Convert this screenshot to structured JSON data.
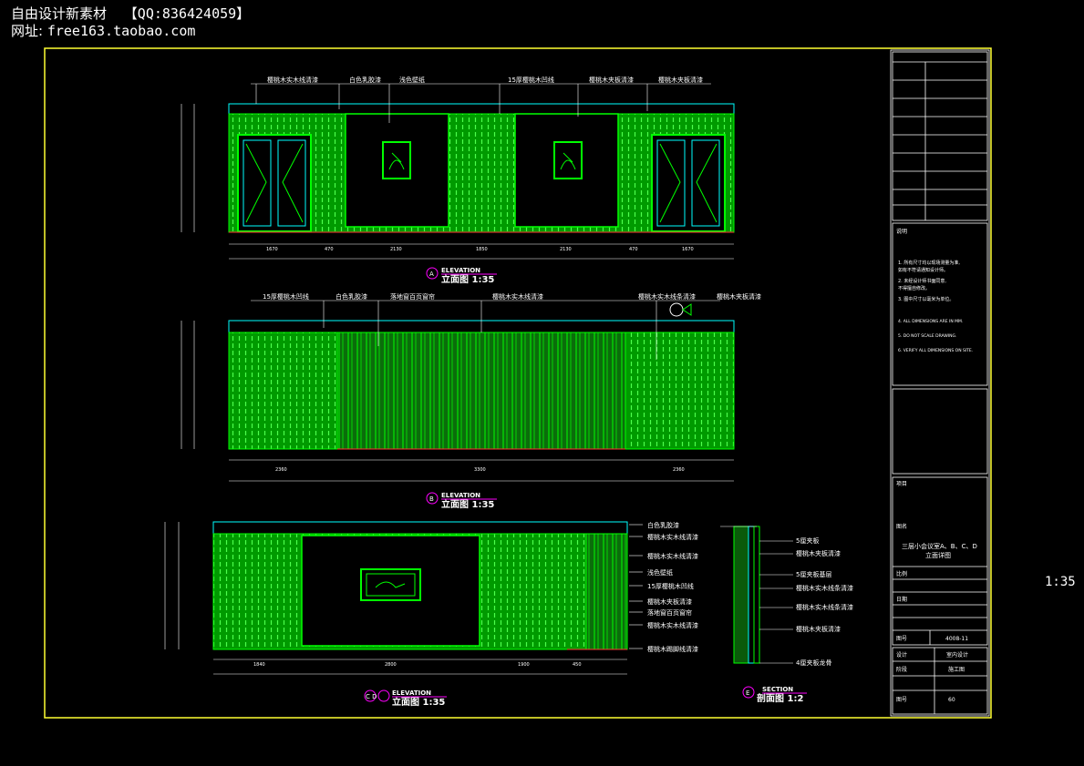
{
  "header": {
    "line1_a": "自由设计新素材",
    "line1_b": "【QQ:836424059】",
    "line2_a": "网址:",
    "line2_b": "free163.taobao.com"
  },
  "side_scale": "1:35",
  "colors": {
    "frame": "#ffff33",
    "panel": "#00ff00",
    "edge": "#00ffff",
    "tag": "#ff00ff",
    "dim": "#ffffff"
  },
  "elevation_a": {
    "callouts": [
      "樱桃木实木线清漆",
      "白色乳胶漆",
      "浅色壁纸",
      "15厚樱桃木凹线",
      "樱桃木夹板清漆",
      "樱桃木夹板清漆"
    ],
    "dims": [
      "1670",
      "470",
      "2130",
      "1850",
      "2130",
      "470",
      "1670"
    ],
    "tag_letter": "A",
    "tag_en": "ELEVATION",
    "tag_cn": "立面图 1:35"
  },
  "elevation_b": {
    "callouts": [
      "15厚樱桃木凹线",
      "白色乳胶漆",
      "落地窗百页窗帘",
      "樱桃木实木线清漆",
      "樱桃木实木线条清漆",
      "樱桃木夹板清漆"
    ],
    "dims": [
      "2360",
      "3300",
      "2360"
    ],
    "tag_letter": "B",
    "tag_en": "ELEVATION",
    "tag_cn": "立面图 1:35"
  },
  "elevation_cd": {
    "callouts": [
      "白色乳胶漆",
      "樱桃木实木线清漆",
      "樱桃木实木线清漆",
      "浅色壁纸",
      "15厚樱桃木凹线",
      "樱桃木夹板清漆",
      "落地窗百页窗帘",
      "樱桃木实木线清漆",
      "樱桃木踢脚线清漆"
    ],
    "dims": [
      "1840",
      "2800",
      "1900",
      "450"
    ],
    "tag_letter": "C D",
    "tag_en": "ELEVATION",
    "tag_cn": "立面图 1:35"
  },
  "section": {
    "callouts": [
      "5厘夹板",
      "樱桃木夹板清漆",
      "5厘夹板基层",
      "樱桃木实木线条清漆",
      "樱桃木实木线条清漆",
      "樱桃木夹板清漆",
      "4厘夹板龙骨"
    ],
    "tag_letter": "E",
    "tag_en": "SECTION",
    "tag_cn": "剖面图 1:2"
  },
  "title_block": {
    "notes_title": "说明",
    "notes": [
      "1. 所有尺寸均以现场测量为准,",
      "   如有不符请通知设计师。",
      "2. 未经设计师书面同意,",
      "   不得擅自修改。",
      "3. 图中尺寸以毫米为单位。",
      "4. ALL DIMENSIONS ARE IN MM.",
      "5. DO NOT SCALE DRAWING.",
      "6. VERIFY ALL DIMENSIONS ON SITE."
    ],
    "project_label": "项目",
    "drawing_label": "图名",
    "drawing_title_1": "三层小会议室A、B、C、D",
    "drawing_title_2": "立面详图",
    "scale_label": "比例",
    "date_label": "日期",
    "no_label": "图号",
    "no_value": "4008-11",
    "design_label": "设计",
    "design_value": "室内设计",
    "stage_label": "阶段",
    "stage_value": "施工图",
    "sheet_label": "图号",
    "sheet_value": "60"
  }
}
